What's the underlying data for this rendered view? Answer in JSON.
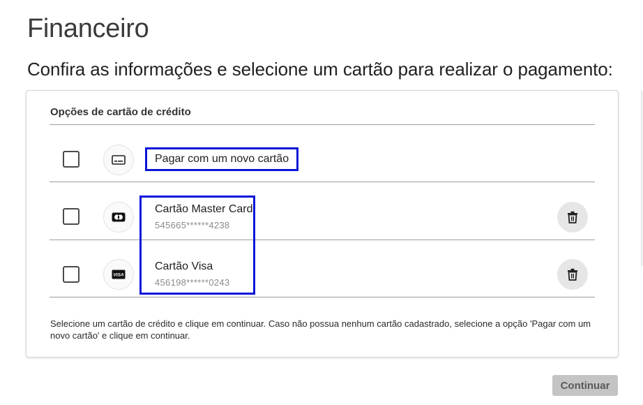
{
  "page": {
    "title": "Financeiro",
    "subtitle": "Confira as informações e selecione um cartão para realizar o pagamento:"
  },
  "card_section": {
    "header": "Opções de cartão de crédito",
    "new_card": {
      "label": "Pagar com um novo cartão",
      "icon": "credit-card-icon"
    },
    "cards": [
      {
        "name": "Cartão Master Card",
        "number": "545665******4238",
        "icon": "mastercard-icon",
        "action_icon": "trash-icon"
      },
      {
        "name": "Cartão Visa",
        "number": "456198******0243",
        "icon": "visa-icon",
        "action_icon": "trash-icon",
        "brand_text": "VISA"
      }
    ],
    "helper_text": "Selecione um cartão de crédito e clique em continuar. Caso não possua nenhum cartão cadastrado, selecione a opção 'Pagar com um novo cartão' e clique em continuar."
  },
  "actions": {
    "continue_label": "Continuar"
  },
  "colors": {
    "highlight": "#0a16d8",
    "button_disabled_bg": "#c4c4c4",
    "divider": "#9e9e9e"
  }
}
